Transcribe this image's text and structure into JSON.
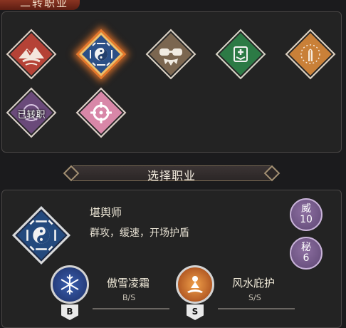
{
  "header": {
    "tab_title": "二转职业"
  },
  "classes": [
    {
      "icon": "mountain-flame-icon",
      "color": "#b54236",
      "status": ""
    },
    {
      "icon": "yin-yang-bagua-icon",
      "color": "#2b4f86",
      "status": "selected"
    },
    {
      "icon": "goggles-mask-icon",
      "color": "#7b6650",
      "status": ""
    },
    {
      "icon": "medic-shield-icon",
      "color": "#2c7a45",
      "status": ""
    },
    {
      "icon": "praying-hands-icon",
      "color": "#c98038",
      "status": ""
    },
    {
      "icon": "purple-emblem-icon",
      "color": "#6a4a7a",
      "status": "已转职"
    },
    {
      "icon": "crosshair-icon",
      "color": "#d887a8",
      "status": ""
    }
  ],
  "section": {
    "title": "选择职业"
  },
  "detail": {
    "class_name": "堪舆师",
    "description": "群攻，缓速，开场护盾",
    "stats": [
      {
        "label": "威",
        "value": "10"
      },
      {
        "label": "秘",
        "value": "6"
      }
    ],
    "skills": [
      {
        "name": "傲雪凌霜",
        "grade": "B/S",
        "badge": "B",
        "icon": "snowflake-icon"
      },
      {
        "name": "风水庇护",
        "grade": "S/S",
        "badge": "S",
        "icon": "meditating-figure-icon"
      }
    ]
  }
}
